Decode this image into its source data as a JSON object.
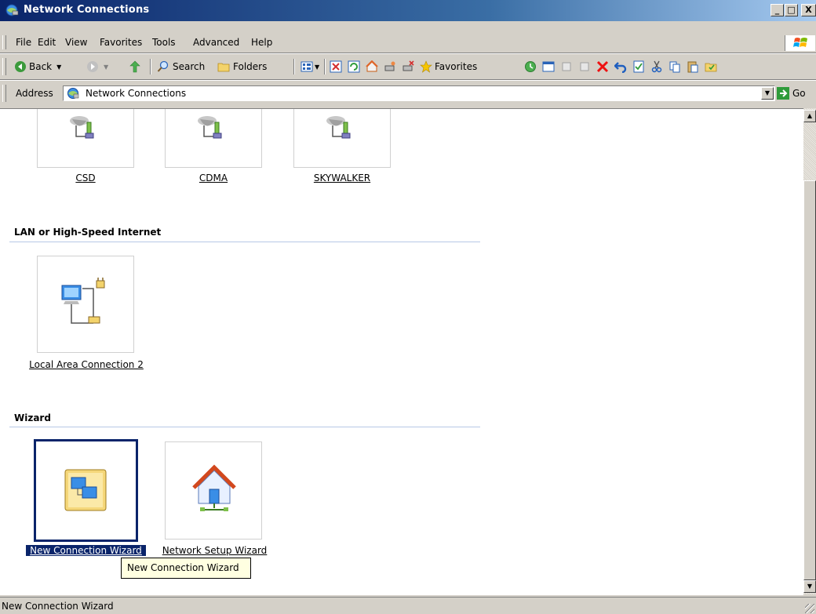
{
  "window": {
    "title": "Network Connections",
    "min": "_",
    "max": "□",
    "close": "X"
  },
  "menu": [
    "File",
    "Edit",
    "View",
    "Favorites",
    "Tools",
    "Advanced",
    "Help"
  ],
  "toolbar": {
    "back": "Back",
    "search": "Search",
    "folders": "Folders",
    "favorites": "Favorites"
  },
  "address": {
    "label": "Address",
    "value": "Network Connections",
    "go": "Go"
  },
  "groups": {
    "dialup": {
      "items": [
        "CSD",
        "CDMA",
        "SKYWALKER"
      ]
    },
    "lan": {
      "title": "LAN or High-Speed Internet",
      "items": [
        "Local Area Connection 2"
      ]
    },
    "wizard": {
      "title": "Wizard",
      "items": [
        "New Connection Wizard",
        "Network Setup Wizard"
      ]
    }
  },
  "tooltip": "New Connection Wizard",
  "status": "New Connection Wizard",
  "colors": {
    "titlebar": "#0a246a",
    "selection": "#0a246a",
    "tooltip_bg": "#ffffe1"
  }
}
